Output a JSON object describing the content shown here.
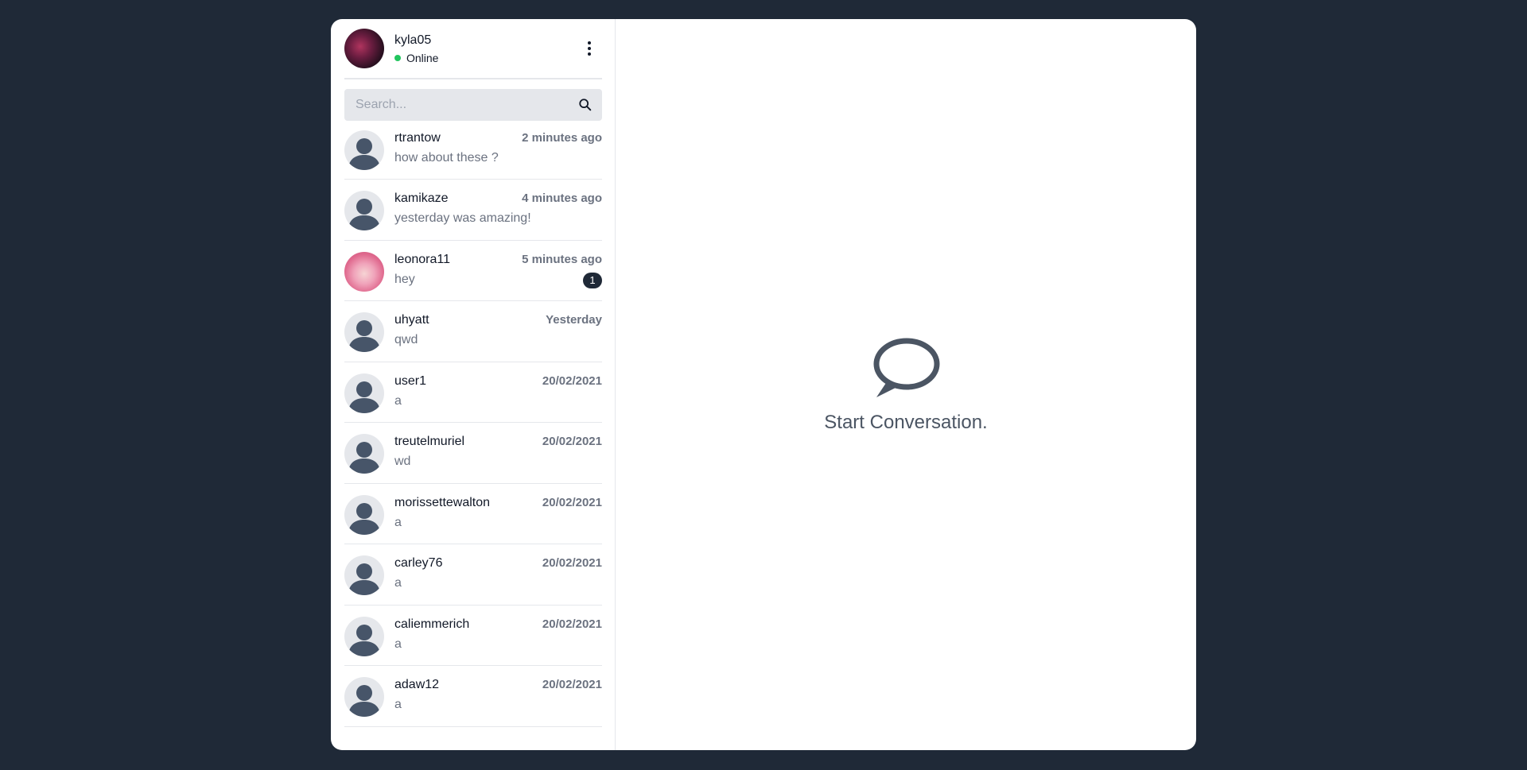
{
  "profile": {
    "username": "kyla05",
    "status": "Online",
    "status_color": "#22c55e"
  },
  "search": {
    "placeholder": "Search...",
    "value": ""
  },
  "contacts": [
    {
      "name": "rtrantow",
      "time": "2 minutes ago",
      "message": "how about these ?",
      "avatar": "default",
      "unread": ""
    },
    {
      "name": "kamikaze",
      "time": "4 minutes ago",
      "message": "yesterday was amazing!",
      "avatar": "default",
      "unread": ""
    },
    {
      "name": "leonora11",
      "time": "5 minutes ago",
      "message": "hey",
      "avatar": "photo",
      "unread": "1"
    },
    {
      "name": "uhyatt",
      "time": "Yesterday",
      "message": "qwd",
      "avatar": "default",
      "unread": ""
    },
    {
      "name": "user1",
      "time": "20/02/2021",
      "message": "a",
      "avatar": "default",
      "unread": ""
    },
    {
      "name": "treutelmuriel",
      "time": "20/02/2021",
      "message": "wd",
      "avatar": "default",
      "unread": ""
    },
    {
      "name": "morissettewalton",
      "time": "20/02/2021",
      "message": "a",
      "avatar": "default",
      "unread": ""
    },
    {
      "name": "carley76",
      "time": "20/02/2021",
      "message": "a",
      "avatar": "default",
      "unread": ""
    },
    {
      "name": "caliemmerich",
      "time": "20/02/2021",
      "message": "a",
      "avatar": "default",
      "unread": ""
    },
    {
      "name": "adaw12",
      "time": "20/02/2021",
      "message": "a",
      "avatar": "default",
      "unread": ""
    }
  ],
  "main": {
    "empty_title": "Start Conversation.",
    "empty_icon": "chat-bubble-icon"
  },
  "colors": {
    "background": "#1f2937",
    "panel": "#ffffff",
    "badge": "#1f2937"
  }
}
